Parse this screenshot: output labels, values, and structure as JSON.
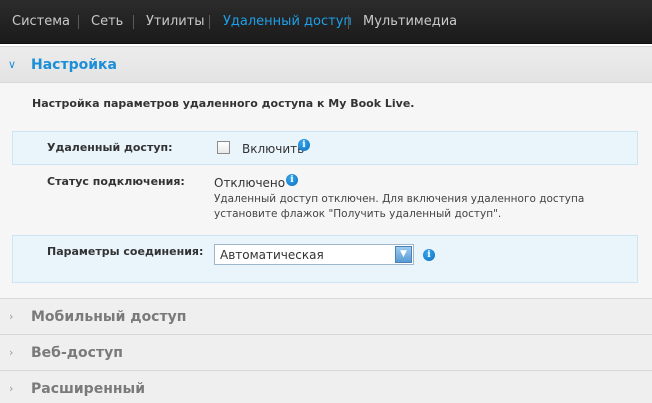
{
  "nav": {
    "items": [
      {
        "label": "Система"
      },
      {
        "label": "Сеть"
      },
      {
        "label": "Утилиты"
      },
      {
        "label": "Удаленный доступ"
      },
      {
        "label": "Мультимедиа"
      }
    ],
    "active_color": "#1ea0e8"
  },
  "panels": {
    "settings": {
      "title": "Настройка",
      "description": "Настройка параметров удаленного доступа к My Book Live.",
      "remote_access": {
        "label": "Удаленный доступ:",
        "checkbox_label": "Включить",
        "checked": false
      },
      "status": {
        "label": "Статус подключения:",
        "value": "Отключено",
        "note_line1": "Удаленный доступ отключен. Для включения удаленного доступа",
        "note_line2": "установите флажок \"Получить удаленный доступ\"."
      },
      "connection": {
        "label": "Параметры соединения:",
        "selected": "Автоматическая"
      }
    },
    "mobile": {
      "title": "Мобильный доступ"
    },
    "web": {
      "title": "Веб-доступ"
    },
    "advanced": {
      "title": "Расширенный"
    }
  },
  "icons": {
    "info": "info-icon",
    "expanded": "chevron-down-icon",
    "collapsed": "chevron-right-icon"
  }
}
